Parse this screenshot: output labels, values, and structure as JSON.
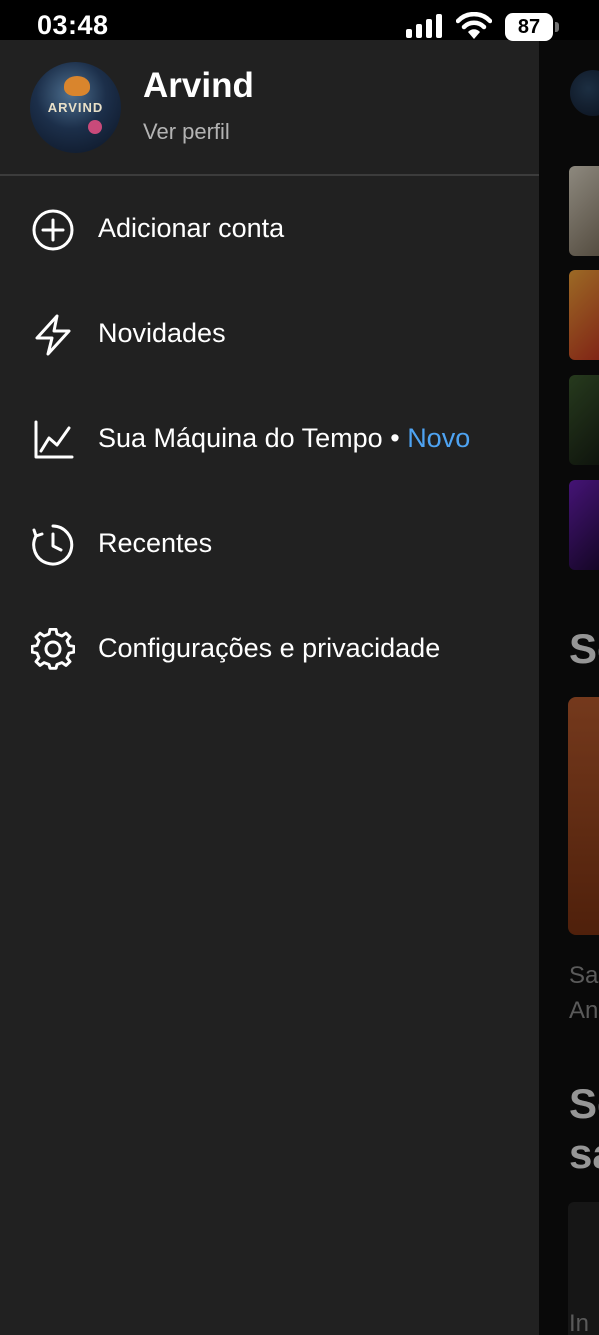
{
  "status_bar": {
    "time": "03:48",
    "battery": "87",
    "icons": [
      "cellular-signal-icon",
      "wifi-icon",
      "battery-icon"
    ]
  },
  "profile": {
    "name": "Arvind",
    "link_label": "Ver perfil",
    "avatar_text": "ARVIND"
  },
  "menu": [
    {
      "label": "Adicionar conta",
      "icon": "add-circle-icon"
    },
    {
      "label": "Novidades",
      "icon": "lightning-icon"
    },
    {
      "label": "Sua Máquina do Tempo",
      "separator": "•",
      "badge": "Novo",
      "icon": "line-chart-icon"
    },
    {
      "label": "Recentes",
      "icon": "history-clock-icon"
    },
    {
      "label": "Configurações e privacidade",
      "icon": "gear-icon"
    }
  ],
  "background": {
    "heading_1": "Se",
    "text_1": "Sa",
    "text_2": "An",
    "heading_2": "Se",
    "heading_3": "sa",
    "small_text": "In"
  },
  "colors": {
    "drawer_bg": "#212121",
    "accent_new": "#4ea3f2",
    "secondary_text": "#b3b3b3"
  }
}
